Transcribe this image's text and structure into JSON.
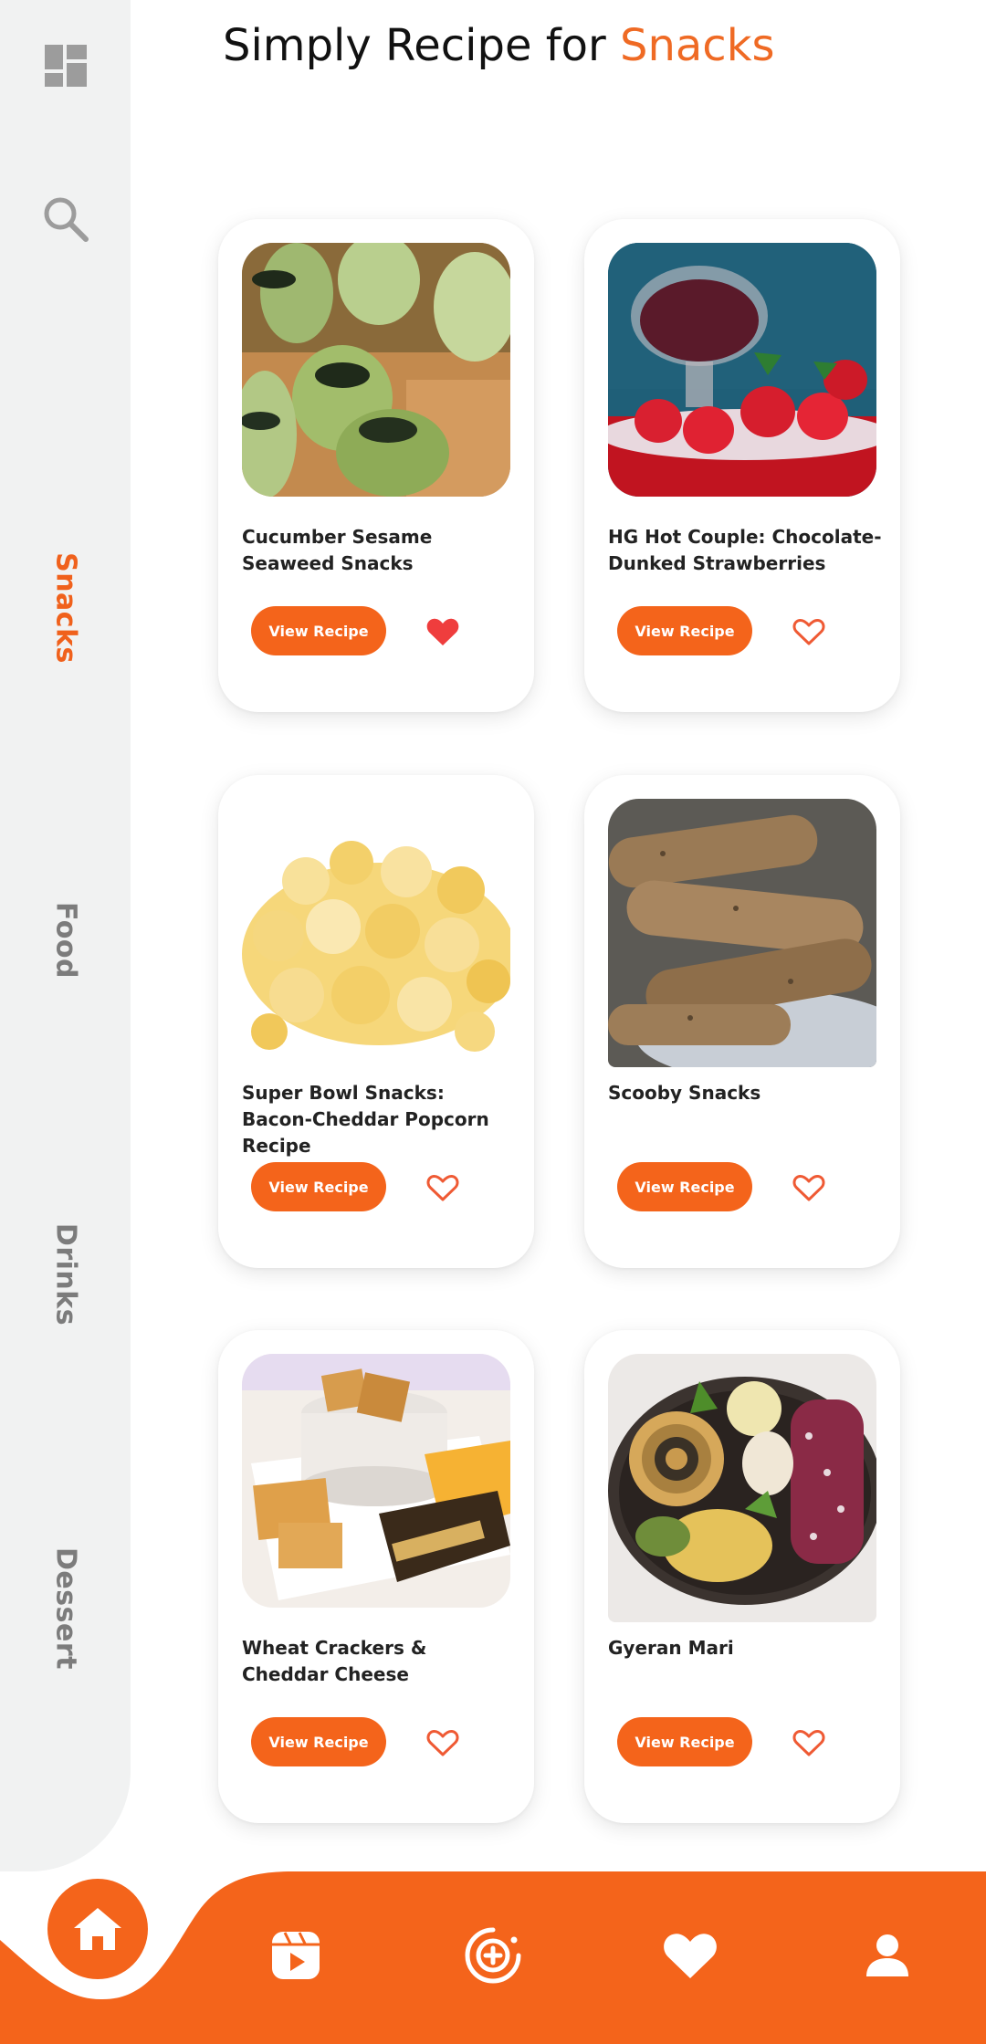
{
  "header": {
    "title_prefix": "Simply Recipe for ",
    "title_accent": "Snacks"
  },
  "sidebar": {
    "icons": [
      "dashboard-icon",
      "search-icon"
    ],
    "categories": [
      {
        "label": "Snacks",
        "active": true
      },
      {
        "label": "Food",
        "active": false
      },
      {
        "label": "Drinks",
        "active": false
      },
      {
        "label": "Dessert",
        "active": false
      }
    ]
  },
  "recipes": [
    {
      "title": "Cucumber Sesame Seaweed Snacks",
      "button": "View Recipe",
      "favorited": true
    },
    {
      "title": "HG Hot Couple: Chocolate-Dunked Strawberries",
      "button": "View Recipe",
      "favorited": false
    },
    {
      "title": "Super Bowl Snacks: Bacon-Cheddar Popcorn Recipe",
      "button": "View Recipe",
      "favorited": false
    },
    {
      "title": "Scooby Snacks",
      "button": "View Recipe",
      "favorited": false
    },
    {
      "title": "Wheat Crackers & Cheddar Cheese",
      "button": "View Recipe",
      "favorited": false
    },
    {
      "title": "Gyeran Mari",
      "button": "View Recipe",
      "favorited": false
    }
  ],
  "bottom_nav": {
    "items": [
      "home-icon",
      "reels-icon",
      "add-icon",
      "favorites-icon",
      "profile-icon"
    ],
    "active": "home-icon"
  },
  "colors": {
    "accent": "#f4641b",
    "sidebar_bg": "#f1f2f2",
    "inactive_text": "#7c7c7c",
    "favorite_red": "#ef3d3d"
  }
}
